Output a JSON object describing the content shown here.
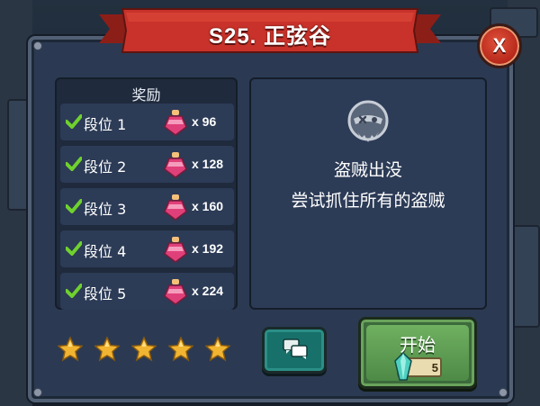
{
  "header": {
    "title": "S25. 正弦谷"
  },
  "close_button": {
    "label": "X"
  },
  "rewards": {
    "title": "奖励",
    "tiers": [
      {
        "label": "段位 1",
        "quantity": "x 96"
      },
      {
        "label": "段位 2",
        "quantity": "x 128"
      },
      {
        "label": "段位 3",
        "quantity": "x 160"
      },
      {
        "label": "段位 4",
        "quantity": "x 192"
      },
      {
        "label": "段位 5",
        "quantity": "x 224"
      }
    ]
  },
  "objective": {
    "title": "盗贼出没",
    "description": "尝试抓住所有的盗贼"
  },
  "stars": {
    "earned": 5,
    "total": 5
  },
  "start_button": {
    "label": "开始",
    "cost": "5"
  },
  "colors": {
    "ribbon": "#c8322a",
    "panel": "#2b3a52",
    "start_button": "#4e8a47",
    "chat_button": "#18706b",
    "check": "#6fd12e",
    "star": "#f2b531"
  },
  "icons": {
    "check": "check-icon",
    "potion": "pink-potion-icon",
    "thief": "thief-mask-icon",
    "star": "gold-star-icon",
    "chat": "chat-bubbles-icon",
    "gem": "crystal-gem-icon"
  }
}
